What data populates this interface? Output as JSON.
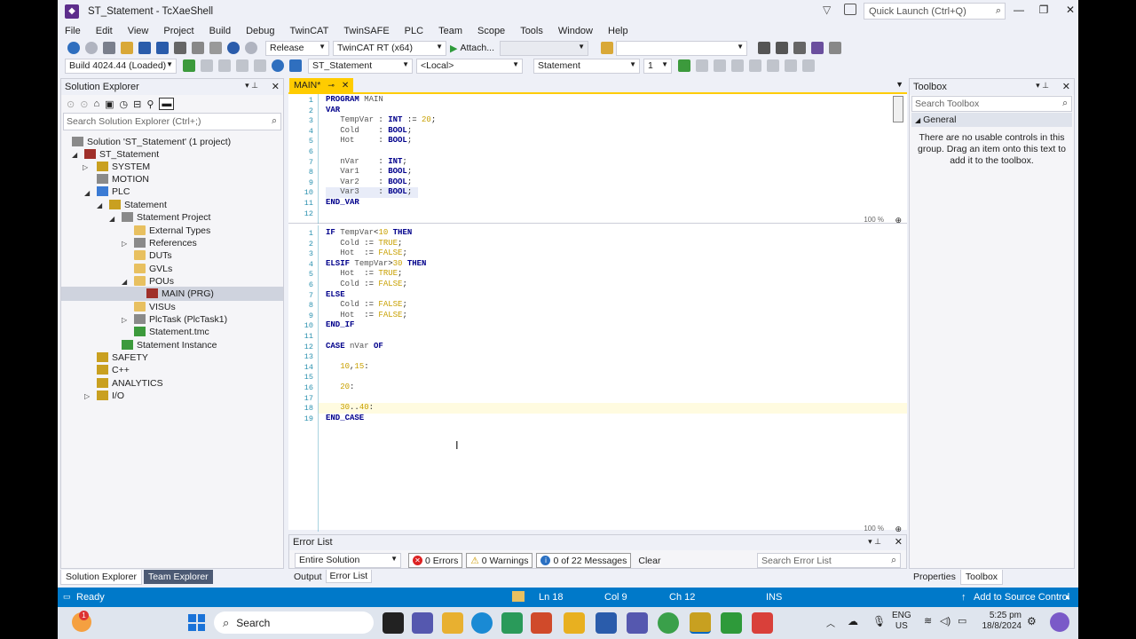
{
  "window": {
    "title": "ST_Statement - TcXaeShell",
    "quick_launch": "Quick Launch (Ctrl+Q)"
  },
  "menu": [
    "File",
    "Edit",
    "View",
    "Project",
    "Build",
    "Debug",
    "TwinCAT",
    "TwinSAFE",
    "PLC",
    "Team",
    "Scope",
    "Tools",
    "Window",
    "Help"
  ],
  "toolbar1": {
    "config": "Release",
    "platform": "TwinCAT RT (x64)",
    "attach": "Attach...",
    "combo_empty": ""
  },
  "toolbar2": {
    "build": "Build 4024.44 (Loaded)",
    "project": "ST_Statement",
    "local": "<Local>",
    "statement": "Statement",
    "instance": "1"
  },
  "solution_explorer": {
    "title": "Solution Explorer",
    "search_placeholder": "Search Solution Explorer (Ctrl+;)",
    "nodes": [
      {
        "label": "Solution 'ST_Statement' (1 project)",
        "icon": "solution-icon"
      },
      {
        "label": "ST_Statement",
        "icon": "twincat-project-icon"
      },
      {
        "label": "SYSTEM",
        "icon": "system-icon"
      },
      {
        "label": "MOTION",
        "icon": "motion-icon"
      },
      {
        "label": "PLC",
        "icon": "plc-icon"
      },
      {
        "label": "Statement",
        "icon": "plc-project-icon"
      },
      {
        "label": "Statement Project",
        "icon": "project-icon"
      },
      {
        "label": "External Types",
        "icon": "folder-icon"
      },
      {
        "label": "References",
        "icon": "references-icon"
      },
      {
        "label": "DUTs",
        "icon": "folder-icon"
      },
      {
        "label": "GVLs",
        "icon": "folder-icon"
      },
      {
        "label": "POUs",
        "icon": "folder-icon"
      },
      {
        "label": "MAIN (PRG)",
        "icon": "program-icon"
      },
      {
        "label": "VISUs",
        "icon": "folder-icon"
      },
      {
        "label": "PlcTask (PlcTask1)",
        "icon": "task-icon"
      },
      {
        "label": "Statement.tmc",
        "icon": "tmc-file-icon"
      },
      {
        "label": "Statement Instance",
        "icon": "instance-icon"
      },
      {
        "label": "SAFETY",
        "icon": "safety-icon"
      },
      {
        "label": "C++",
        "icon": "cpp-icon"
      },
      {
        "label": "ANALYTICS",
        "icon": "analytics-icon"
      },
      {
        "label": "I/O",
        "icon": "io-icon"
      }
    ],
    "bottom_tabs": [
      "Solution Explorer",
      "Team Explorer"
    ]
  },
  "editor": {
    "tab": "MAIN*",
    "declaration_lines": [
      "1",
      "2",
      "3",
      "4",
      "5",
      "6",
      "7",
      "8",
      "9",
      "10",
      "11",
      "12"
    ],
    "body_lines": [
      "1",
      "2",
      "3",
      "4",
      "5",
      "6",
      "7",
      "8",
      "9",
      "10",
      "11",
      "12",
      "13",
      "14",
      "15",
      "16",
      "17",
      "18",
      "19"
    ],
    "zoom_top": "100 %",
    "zoom_bottom": "100 %"
  },
  "error_list": {
    "title": "Error List",
    "scope": "Entire Solution",
    "errors": "0 Errors",
    "warnings": "0 Warnings",
    "messages": "0 of 22 Messages",
    "clear": "Clear",
    "search_placeholder": "Search Error List",
    "tabs": [
      "Output",
      "Error List"
    ]
  },
  "toolbox": {
    "title": "Toolbox",
    "search_placeholder": "Search Toolbox",
    "group": "General",
    "empty_text": "There are no usable controls in this group. Drag an item onto this text to add it to the toolbox.",
    "bottom_tabs": [
      "Properties",
      "Toolbox"
    ]
  },
  "status": {
    "ready": "Ready",
    "ln": "Ln 18",
    "col": "Col 9",
    "ch": "Ch 12",
    "ins": "INS",
    "source_control": "Add to Source Control"
  },
  "taskbar": {
    "search": "Search",
    "lang_line1": "ENG",
    "lang_line2": "US",
    "time": "5:25 pm",
    "date": "18/8/2024",
    "notify_badge": "1"
  },
  "colors": {
    "accent": "#0079c9",
    "tab_active": "#ffcc00",
    "keyword": "#00008b",
    "literal": "#c8a000"
  }
}
